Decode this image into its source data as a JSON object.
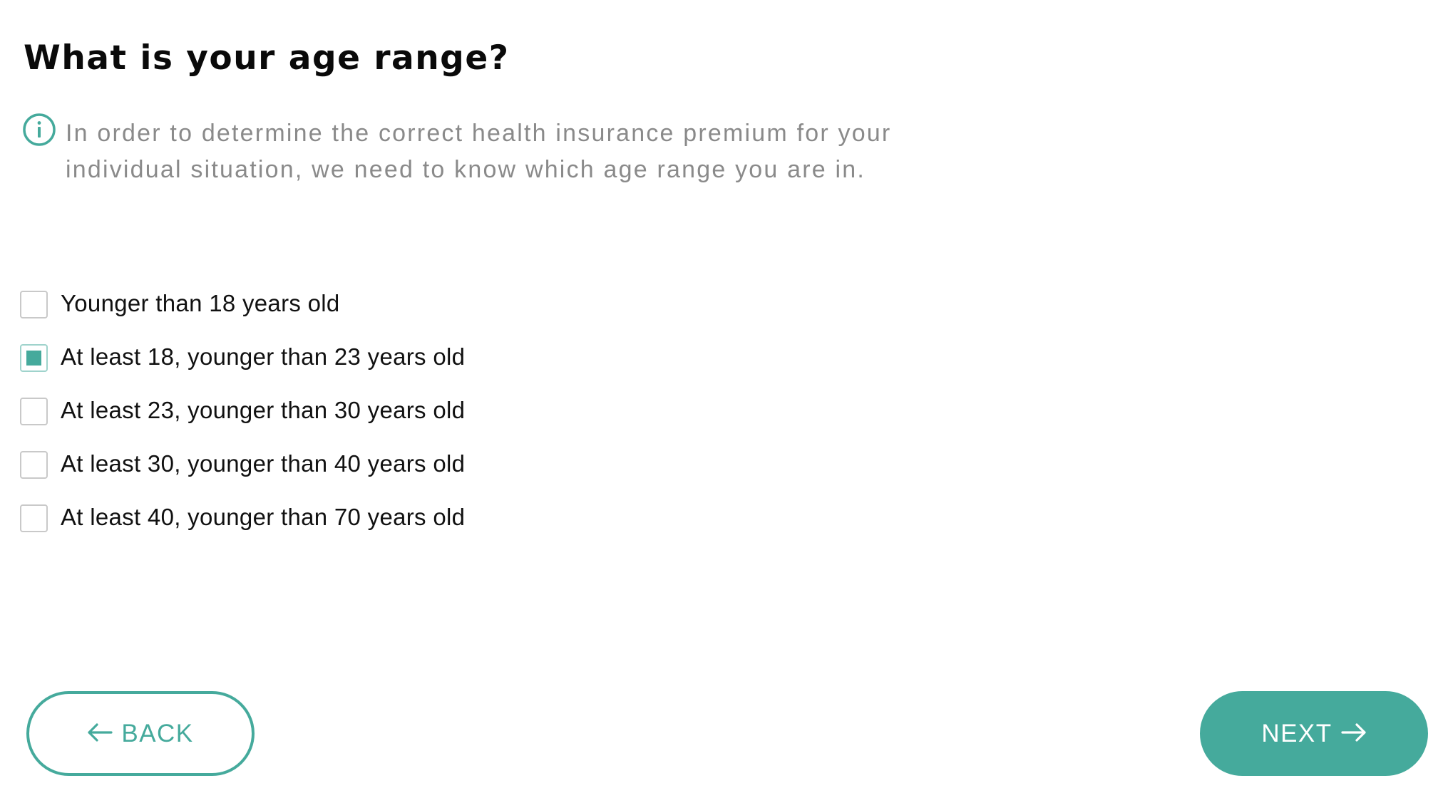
{
  "question": {
    "title": "What is your age range?",
    "info_icon": "info-circle-icon",
    "info_text": "In order to determine the correct health insurance premium for your individual situation, we need to know which age range you are in."
  },
  "options": [
    {
      "label": "Younger than 18 years old",
      "checked": false
    },
    {
      "label": "At least 18, younger than 23 years old",
      "checked": true
    },
    {
      "label": "At least 23, younger than 30 years old",
      "checked": false
    },
    {
      "label": "At least 30, younger than 40 years old",
      "checked": false
    },
    {
      "label": "At least 40, younger than 70 years old",
      "checked": false
    }
  ],
  "navigation": {
    "back_label": "BACK",
    "back_icon": "arrow-left-icon",
    "next_label": "NEXT",
    "next_icon": "arrow-right-icon"
  },
  "colors": {
    "accent": "#45aa9c",
    "title": "#0a0a0a",
    "info_text": "#8a8a8a",
    "checkbox_border": "#c9c9c9"
  }
}
